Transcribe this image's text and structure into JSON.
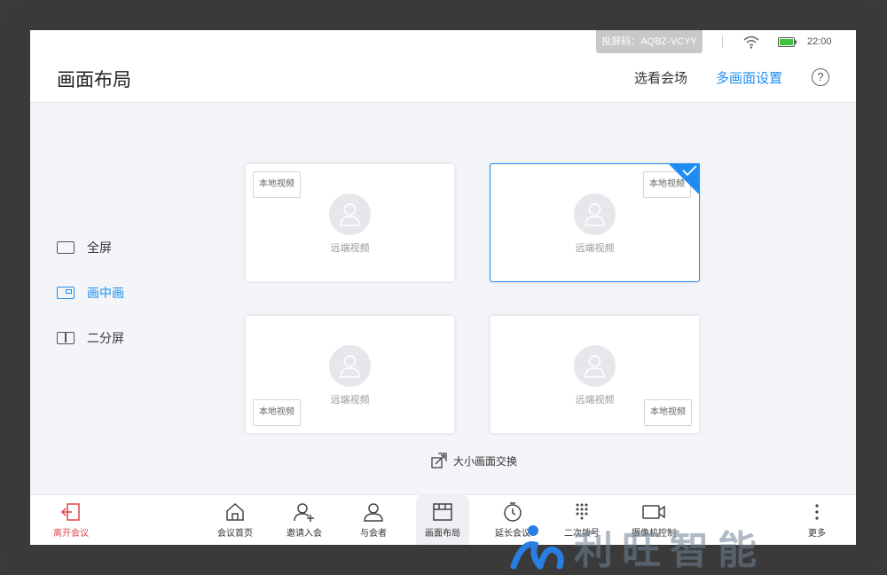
{
  "status": {
    "cast_code": "投屏码：AQBZ-VCYY",
    "time": "22:00"
  },
  "header": {
    "title": "画面布局",
    "select_venue": "选看会场",
    "multi_settings": "多画面设置",
    "help": "?"
  },
  "layouts": [
    {
      "label": "全屏",
      "active": false
    },
    {
      "label": "画中画",
      "active": true
    },
    {
      "label": "二分屏",
      "active": false
    }
  ],
  "cards": [
    {
      "local": "本地视频",
      "remote": "远端视频",
      "selected": false
    },
    {
      "local": "本地视频",
      "remote": "远端视频",
      "selected": true
    },
    {
      "local": "本地视频",
      "remote": "远端视频",
      "selected": false
    },
    {
      "local": "本地视频",
      "remote": "远端视频",
      "selected": false
    }
  ],
  "swap_label": "大小画面交换",
  "toolbar": {
    "leave": "离开会议",
    "home": "会议首页",
    "invite": "邀请入会",
    "participants": "与会者",
    "layout": "画面布局",
    "extend": "延长会议",
    "dial": "二次拨号",
    "camera": "摄像机控制",
    "more": "更多"
  },
  "watermark": "利旺智能",
  "colors": {
    "accent": "#1e8cf0",
    "danger": "#e14545"
  }
}
